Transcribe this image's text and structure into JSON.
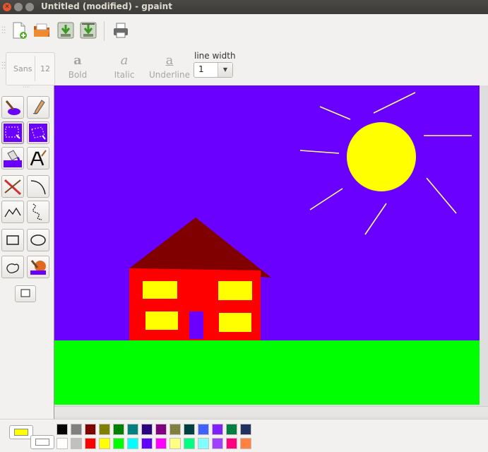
{
  "window": {
    "title": "Untitled (modified) - gpaint"
  },
  "toolbar": {
    "buttons": [
      "new-file-icon",
      "open-folder-icon",
      "save-icon",
      "save-as-icon",
      "print-icon"
    ]
  },
  "text_style": {
    "font_name": "Sans",
    "font_size": "12",
    "bold_label": "Bold",
    "italic_label": "Italic",
    "underline_label": "Underline",
    "glyph": "a",
    "line_width_label": "line width",
    "line_width_value": "1"
  },
  "tools": [
    "paint-brush-icon",
    "pencil-icon",
    "rect-select-icon",
    "lasso-select-icon",
    "fill-bucket-icon",
    "text-tool-icon",
    "line-tool-icon",
    "curve-tool-icon",
    "polyline-tool-icon",
    "freehand-shape-icon",
    "rectangle-tool-icon",
    "ellipse-tool-icon",
    "closed-freehand-icon",
    "eraser-icon"
  ],
  "colors": {
    "foreground": "#ffff00",
    "background": "#ffffff",
    "canvas_sky": "#6a00ff",
    "grass": "#00ff00",
    "sun": "#ffff00",
    "roof": "#800000",
    "wall": "#ff0000",
    "window": "#ffff00",
    "door": "#6a00ff"
  },
  "palette": {
    "row1": [
      "#000000",
      "#808080",
      "#800000",
      "#808000",
      "#008000",
      "#008080",
      "#2a0080",
      "#800080",
      "#808040",
      "#004040",
      "#4060ff",
      "#8020ff",
      "#008040",
      "#203060"
    ],
    "row2": [
      "#ffffff",
      "#c0c0c0",
      "#ff0000",
      "#ffff00",
      "#00ff00",
      "#00ffff",
      "#6000ff",
      "#ff00ff",
      "#ffff80",
      "#00ff80",
      "#80ffff",
      "#a040ff",
      "#ff0080",
      "#ff8040"
    ]
  }
}
